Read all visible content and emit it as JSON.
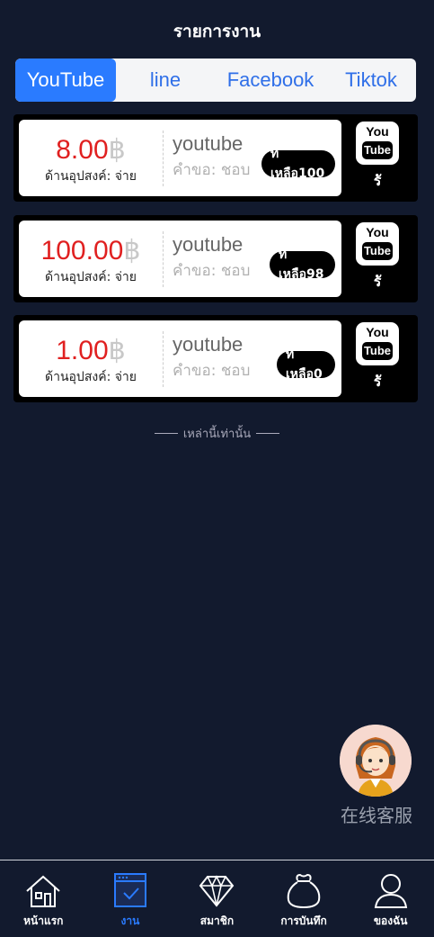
{
  "header": {
    "title": "รายการงาน"
  },
  "tabs": [
    {
      "label": "YouTube",
      "active": true
    },
    {
      "label": "line",
      "active": false
    },
    {
      "label": "Facebook",
      "active": false
    },
    {
      "label": "Tiktok",
      "active": false
    }
  ],
  "tasks": [
    {
      "amount": "8.00",
      "currency": "฿",
      "subtitle": "ด้านอุปสงค์: จ่าย",
      "platform": "youtube",
      "requirement": "คำขอ: ชอบ",
      "remaining": "ที่เหลือ100",
      "icon_label": "รั"
    },
    {
      "amount": "100.00",
      "currency": "฿",
      "subtitle": "ด้านอุปสงค์: จ่าย",
      "platform": "youtube",
      "requirement": "คำขอ: ชอบ",
      "remaining": "ที่เหลือ98",
      "icon_label": "รั"
    },
    {
      "amount": "1.00",
      "currency": "฿",
      "subtitle": "ด้านอุปสงค์: จ่าย",
      "platform": "youtube",
      "requirement": "คำขอ: ชอบ",
      "remaining": "ที่เหลือ0",
      "icon_label": "รั"
    }
  ],
  "youtube_logo": {
    "top": "You",
    "bottom": "Tube"
  },
  "end_note": "เหล่านี้เท่านั้น",
  "support": {
    "label": "在线客服",
    "icon": "customer-service-avatar-icon"
  },
  "nav": [
    {
      "label": "หน้าแรก",
      "icon": "home-icon",
      "active": false
    },
    {
      "label": "งาน",
      "icon": "task-icon",
      "active": true
    },
    {
      "label": "สมาชิก",
      "icon": "diamond-icon",
      "active": false
    },
    {
      "label": "การบันทึก",
      "icon": "bag-icon",
      "active": false
    },
    {
      "label": "ของฉัน",
      "icon": "user-icon",
      "active": false
    }
  ],
  "colors": {
    "background": "#121a2e",
    "accent": "#2a7bff",
    "price": "#e02020"
  }
}
